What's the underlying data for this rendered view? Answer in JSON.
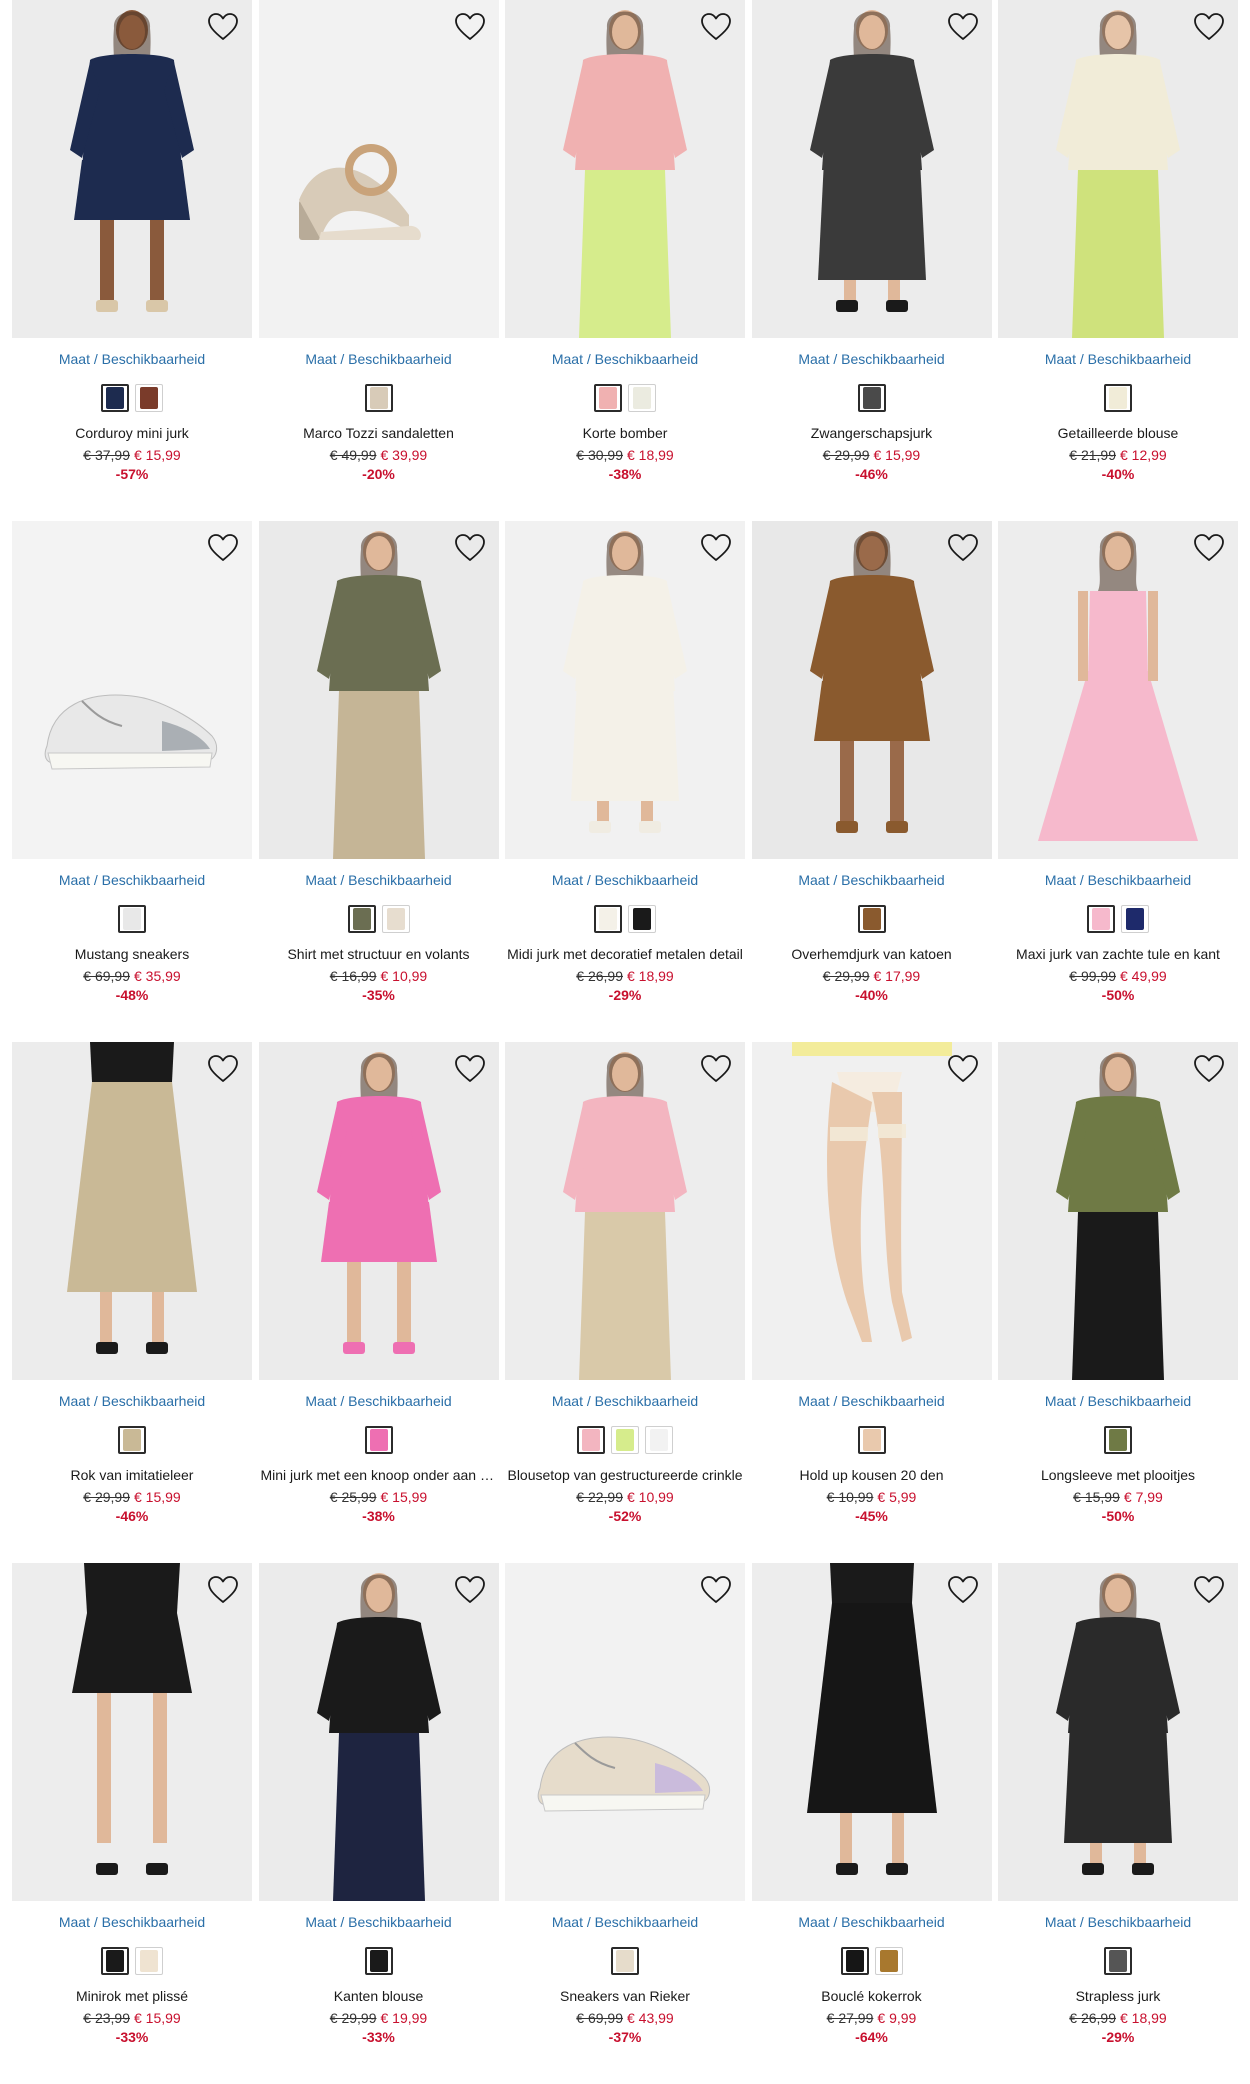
{
  "common": {
    "size_link_label": "Maat / Beschikbaarheid"
  },
  "products": [
    {
      "name": "Corduroy mini jurk",
      "old_price": "€ 37,99",
      "new_price": "€ 15,99",
      "discount": "-57%",
      "bg": "#ececec",
      "garment": "#1d2b4f",
      "skin": "#8a5a3c",
      "kind": "dress",
      "shoes": "#d9c7a8",
      "swatches": [
        "#1d2b4f",
        "#7a3b2a"
      ]
    },
    {
      "name": "Marco Tozzi sandaletten",
      "old_price": "€ 49,99",
      "new_price": "€ 39,99",
      "discount": "-20%",
      "bg": "#f2f2f2",
      "garment": "#d8cbb8",
      "skin": "#d8cbb8",
      "kind": "sandal",
      "shoes": "#d8cbb8",
      "swatches": [
        "#d8cbb8"
      ]
    },
    {
      "name": "Korte bomber",
      "old_price": "€ 30,99",
      "new_price": "€ 18,99",
      "discount": "-38%",
      "bg": "#ededed",
      "garment": "#f0b1b1",
      "skin": "#e0b89a",
      "kind": "top",
      "shoes": "#d6ec8c",
      "swatches": [
        "#f0b1b1",
        "#ebebe0"
      ]
    },
    {
      "name": "Zwangerschapsjurk",
      "old_price": "€ 29,99",
      "new_price": "€ 15,99",
      "discount": "-46%",
      "bg": "#ececec",
      "garment": "#3a3a3a",
      "skin": "#e0b89a",
      "kind": "dress-long",
      "shoes": "#1a1a1a",
      "swatches": [
        "#4a4a4a"
      ]
    },
    {
      "name": "Getailleerde blouse",
      "old_price": "€ 21,99",
      "new_price": "€ 12,99",
      "discount": "-40%",
      "bg": "#ebebeb",
      "garment": "#f1ecd8",
      "skin": "#e6c4a8",
      "kind": "top",
      "shoes": "#cfe27c",
      "swatches": [
        "#f1ecd8"
      ]
    },
    {
      "name": "Mustang sneakers",
      "old_price": "€ 69,99",
      "new_price": "€ 35,99",
      "discount": "-48%",
      "bg": "#f3f3f3",
      "garment": "#e8e8e8",
      "skin": "#e8e8e8",
      "kind": "sneaker",
      "shoes": "#9aa0a6",
      "swatches": [
        "#e8e8e8"
      ]
    },
    {
      "name": "Shirt met structuur en volants",
      "old_price": "€ 16,99",
      "new_price": "€ 10,99",
      "discount": "-35%",
      "bg": "#eaeaea",
      "garment": "#6b6e52",
      "skin": "#e0b89a",
      "kind": "top",
      "shoes": "#c5b596",
      "swatches": [
        "#6b6e52",
        "#e7ddcf"
      ]
    },
    {
      "name": "Midi jurk met decoratief metalen detail",
      "old_price": "€ 26,99",
      "new_price": "€ 18,99",
      "discount": "-29%",
      "bg": "#f1f1f1",
      "garment": "#f4f1e8",
      "skin": "#e0b89a",
      "kind": "dress-long",
      "shoes": "#f0ece2",
      "swatches": [
        "#f4f1e8",
        "#1a1a1a"
      ]
    },
    {
      "name": "Overhemdjurk van katoen",
      "old_price": "€ 29,99",
      "new_price": "€ 17,99",
      "discount": "-40%",
      "bg": "#e8e8e8",
      "garment": "#8a5a2e",
      "skin": "#9a6a4a",
      "kind": "dress",
      "shoes": "#8a5a2e",
      "swatches": [
        "#8a5a2e"
      ]
    },
    {
      "name": "Maxi jurk van zachte tule en kant",
      "old_price": "€ 99,99",
      "new_price": "€ 49,99",
      "discount": "-50%",
      "bg": "#ededed",
      "garment": "#f6b9cc",
      "skin": "#e0b89a",
      "kind": "gown",
      "shoes": "#f6b9cc",
      "swatches": [
        "#f6b9cc",
        "#1e2a6b"
      ]
    },
    {
      "name": "Rok van imitatieleer",
      "old_price": "€ 29,99",
      "new_price": "€ 15,99",
      "discount": "-46%",
      "bg": "#ececec",
      "garment": "#c9b996",
      "skin": "#e0b89a",
      "kind": "skirt",
      "shoes": "#1a1a1a",
      "swatches": [
        "#c9b996"
      ]
    },
    {
      "name": "Mini jurk met een knoop onder aan de hals",
      "old_price": "€ 25,99",
      "new_price": "€ 15,99",
      "discount": "-38%",
      "bg": "#ebebeb",
      "garment": "#ee6fb2",
      "skin": "#e0b89a",
      "kind": "dress",
      "shoes": "#ee6fb2",
      "swatches": [
        "#ee6fb2"
      ]
    },
    {
      "name": "Blousetop van gestructureerde crinkle",
      "old_price": "€ 22,99",
      "new_price": "€ 10,99",
      "discount": "-52%",
      "bg": "#ededed",
      "garment": "#f3b5c0",
      "skin": "#e0b89a",
      "kind": "top",
      "shoes": "#d9c9a9",
      "swatches": [
        "#f3b5c0",
        "#d6ec8c",
        "#f2f2f2"
      ]
    },
    {
      "name": "Hold up kousen 20 den",
      "old_price": "€ 10,99",
      "new_price": "€ 5,99",
      "discount": "-45%",
      "bg": "#f0f0f0",
      "garment": "#e9c9ad",
      "skin": "#e9c9ad",
      "kind": "legs",
      "shoes": "#f3ec9a",
      "swatches": [
        "#e9c9ad"
      ]
    },
    {
      "name": "Longsleeve met plooitjes",
      "old_price": "€ 15,99",
      "new_price": "€ 7,99",
      "discount": "-50%",
      "bg": "#ebebeb",
      "garment": "#6f7a45",
      "skin": "#e0b89a",
      "kind": "top",
      "shoes": "#1a1a1a",
      "swatches": [
        "#6f7a45"
      ]
    },
    {
      "name": "Minirok met plissé",
      "old_price": "€ 23,99",
      "new_price": "€ 15,99",
      "discount": "-33%",
      "bg": "#ededed",
      "garment": "#1a1a1a",
      "skin": "#e0b89a",
      "kind": "skirt-mini",
      "shoes": "#1a1a1a",
      "swatches": [
        "#1a1a1a",
        "#efe3d1"
      ]
    },
    {
      "name": "Kanten blouse",
      "old_price": "€ 29,99",
      "new_price": "€ 19,99",
      "discount": "-33%",
      "bg": "#ebebeb",
      "garment": "#1a1a1a",
      "skin": "#e0b89a",
      "kind": "top",
      "shoes": "#1e2440",
      "swatches": [
        "#1a1a1a"
      ]
    },
    {
      "name": "Sneakers van Rieker",
      "old_price": "€ 69,99",
      "new_price": "€ 43,99",
      "discount": "-37%",
      "bg": "#f2f2f2",
      "garment": "#e6dccb",
      "skin": "#e6dccb",
      "kind": "sneaker",
      "shoes": "#c3b3e0",
      "swatches": [
        "#e6dccb"
      ]
    },
    {
      "name": "Bouclé kokerrok",
      "old_price": "€ 27,99",
      "new_price": "€ 9,99",
      "discount": "-64%",
      "bg": "#ededed",
      "garment": "#161616",
      "skin": "#e0b89a",
      "kind": "skirt",
      "shoes": "#1a1a1a",
      "swatches": [
        "#161616",
        "#a8782e"
      ]
    },
    {
      "name": "Strapless jurk",
      "old_price": "€ 26,99",
      "new_price": "€ 18,99",
      "discount": "-29%",
      "bg": "#ebebeb",
      "garment": "#2a2a2a",
      "skin": "#e0b89a",
      "kind": "dress-long",
      "shoes": "#1a1a1a",
      "swatches": [
        "#555555"
      ]
    }
  ]
}
